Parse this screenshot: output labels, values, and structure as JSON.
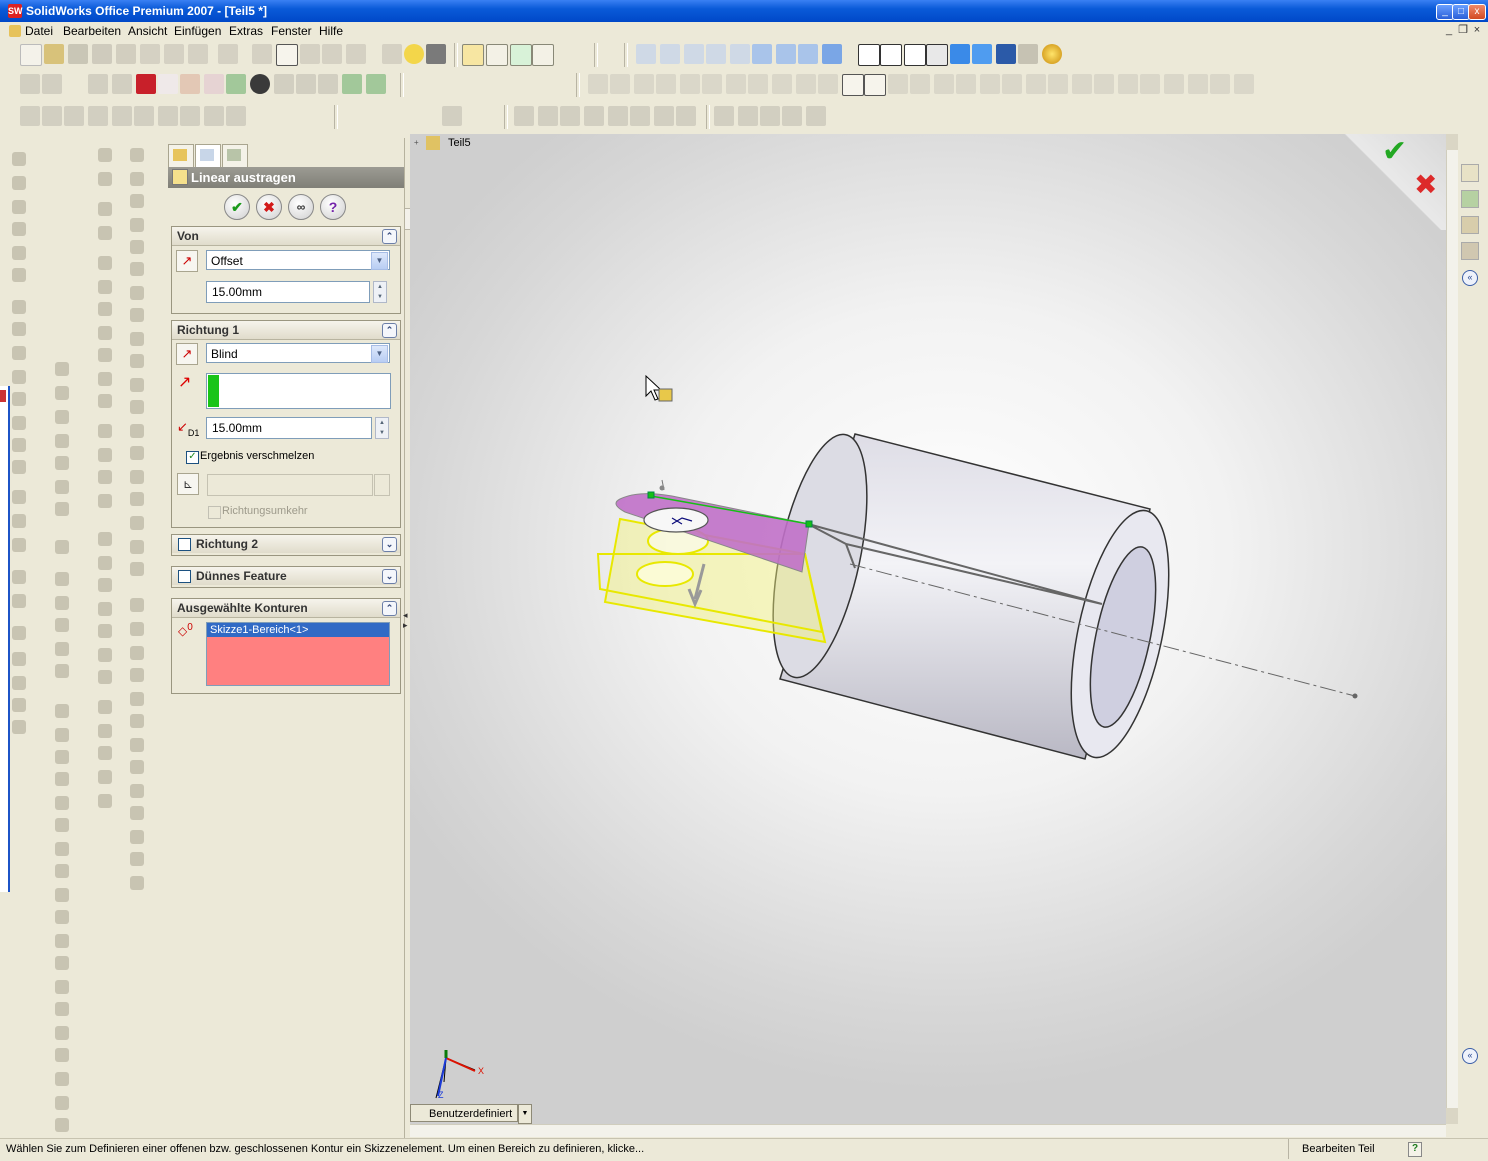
{
  "window": {
    "title": "SolidWorks Office Premium 2007 - [Teil5 *]",
    "app_icon": "SW"
  },
  "menu": [
    "Datei",
    "Bearbeiten",
    "Ansicht",
    "Einfügen",
    "Extras",
    "Fenster",
    "Hilfe"
  ],
  "tree": {
    "root_label": "Teil5"
  },
  "property_manager": {
    "title": "Linear austragen",
    "von": {
      "label": "Von",
      "condition": "Offset",
      "offset_value": "15.00mm"
    },
    "richtung1": {
      "label": "Richtung 1",
      "condition": "Blind",
      "depth_label": "D1",
      "depth_value": "15.00mm",
      "merge_label": "Ergebnis verschmelzen",
      "reverse_label": "Richtungsumkehr"
    },
    "richtung2": {
      "label": "Richtung 2"
    },
    "thin_feature": {
      "label": "Dünnes Feature"
    },
    "contours": {
      "label": "Ausgewählte Konturen",
      "count": "0",
      "items": [
        "Skizze1-Bereich<1>"
      ]
    }
  },
  "viewport": {
    "view_orientation": "Benutzerdefiniert",
    "triad_x": "X",
    "triad_y": "Y",
    "triad_z": "Z"
  },
  "status": {
    "message": "Wählen Sie zum Definieren einer offenen bzw. geschlossenen Kontur ein Skizzenelement. Um einen Bereich zu definieren, klicke...",
    "mode": "Bearbeiten Teil",
    "help": "?"
  },
  "colors": {
    "titlebar": "#0a5ad8",
    "selected_list_item": "#316ac5",
    "contour_list_bg": "#ff8080",
    "preview_yellow": "#f0f000",
    "sketch_magenta": "#c070c8"
  }
}
